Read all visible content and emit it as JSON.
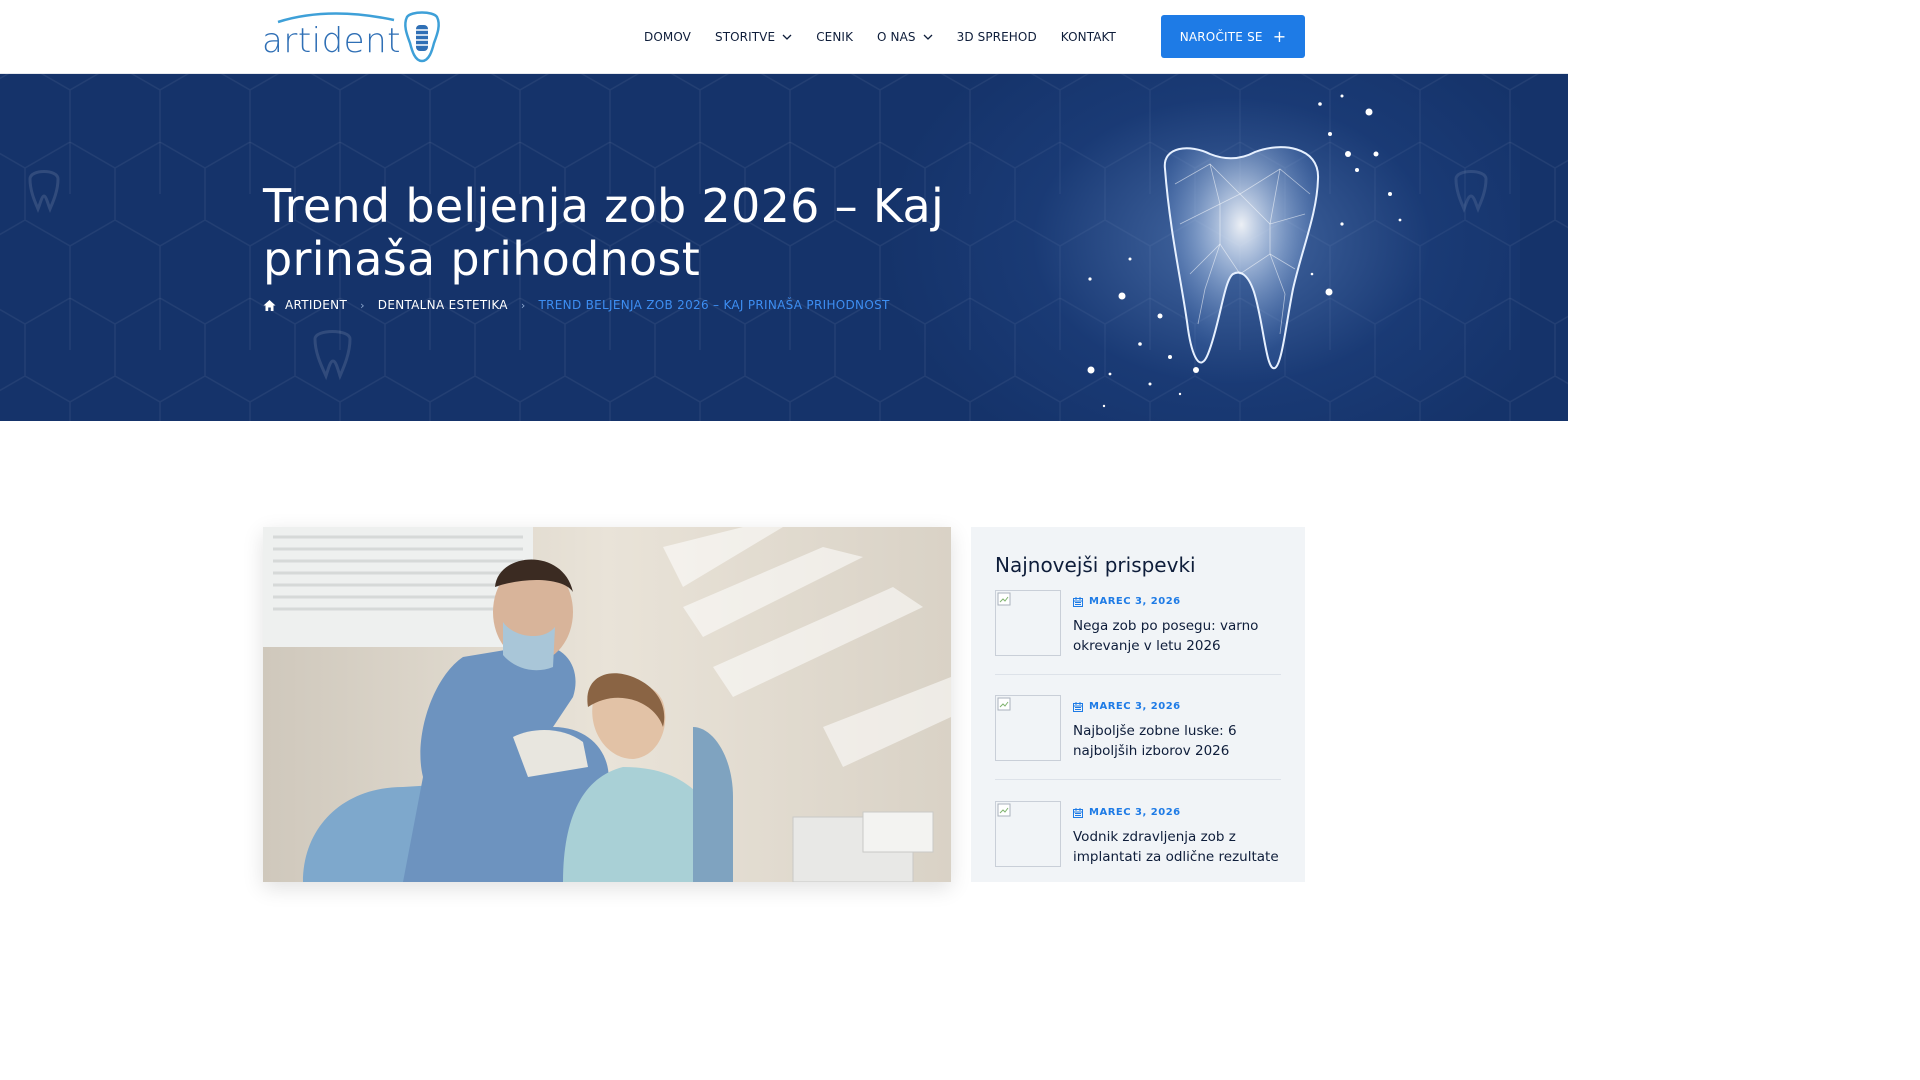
{
  "brand": {
    "logo_text": "artident",
    "accent_color": "#1e7be6",
    "hero_color": "#15336a"
  },
  "nav": {
    "items": [
      {
        "label": "DOMOV",
        "has_dropdown": false
      },
      {
        "label": "STORITVE",
        "has_dropdown": true
      },
      {
        "label": "CENIK",
        "has_dropdown": false
      },
      {
        "label": "O NAS",
        "has_dropdown": true
      },
      {
        "label": "3D SPREHOD",
        "has_dropdown": false
      },
      {
        "label": "KONTAKT",
        "has_dropdown": false
      }
    ],
    "cta_label": "NAROČITE SE",
    "cta_icon": "plus-icon"
  },
  "hero": {
    "title": "Trend beljenja zob 2026 – Kaj prinaša prihodnost",
    "breadcrumb": [
      "ARTIDENT",
      "DENTALNA ESTETIKA",
      "TREND BELJENJA ZOB 2026 – KAJ PRINAŠA PRIHODNOST"
    ],
    "breadcrumb_icon": "home-icon"
  },
  "sidebar": {
    "title": "Najnovejši prispevki",
    "posts": [
      {
        "date": "MAREC 3, 2026",
        "title": "Nega zob po posegu: varno okrevanje v letu 2026"
      },
      {
        "date": "MAREC 3, 2026",
        "title": "Najboljše zobne luske: 6 najboljših izborov 2026"
      },
      {
        "date": "MAREC 3, 2026",
        "title": "Vodnik zdravljenja zob z implantati za odlične rezultate"
      }
    ]
  }
}
